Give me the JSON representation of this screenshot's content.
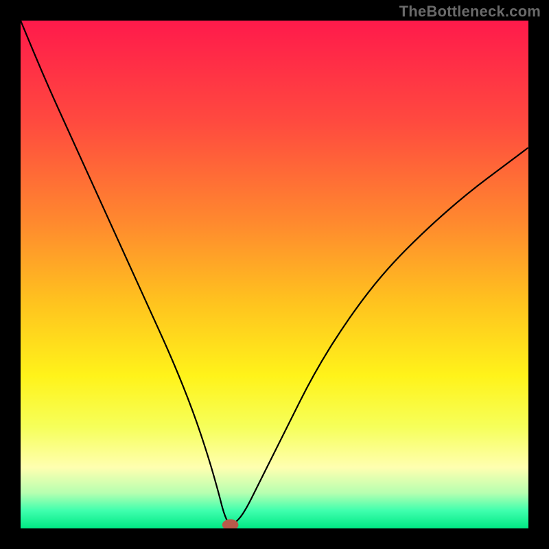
{
  "watermark": "TheBottleneck.com",
  "chart_data": {
    "type": "line",
    "title": "",
    "xlabel": "",
    "ylabel": "",
    "xlim": [
      0,
      100
    ],
    "ylim": [
      0,
      100
    ],
    "grid": false,
    "legend": false,
    "background_gradient": {
      "stops": [
        {
          "offset": 0.0,
          "color": "#ff1a4b"
        },
        {
          "offset": 0.2,
          "color": "#ff4a3f"
        },
        {
          "offset": 0.4,
          "color": "#ff8a2e"
        },
        {
          "offset": 0.55,
          "color": "#ffc11f"
        },
        {
          "offset": 0.7,
          "color": "#fff31a"
        },
        {
          "offset": 0.8,
          "color": "#f6ff5a"
        },
        {
          "offset": 0.88,
          "color": "#ffffb0"
        },
        {
          "offset": 0.93,
          "color": "#b7ffb0"
        },
        {
          "offset": 0.965,
          "color": "#3fffae"
        },
        {
          "offset": 1.0,
          "color": "#00e884"
        }
      ]
    },
    "series": [
      {
        "name": "bottleneck-curve",
        "color": "#000000",
        "width": 2.2,
        "x": [
          0,
          5,
          10,
          15,
          20,
          25,
          30,
          34,
          37,
          39,
          40,
          41,
          42,
          44,
          47,
          52,
          58,
          65,
          72,
          80,
          88,
          96,
          100
        ],
        "y": [
          100,
          88,
          77,
          66,
          55,
          44,
          33,
          23,
          14,
          7,
          3,
          0.8,
          0.8,
          3,
          9,
          19,
          31,
          42,
          51,
          59,
          66,
          72,
          75
        ]
      }
    ],
    "marker": {
      "x": 41.3,
      "y": 0.7,
      "rx": 1.6,
      "ry": 1.1,
      "color": "#b85a4a"
    }
  }
}
